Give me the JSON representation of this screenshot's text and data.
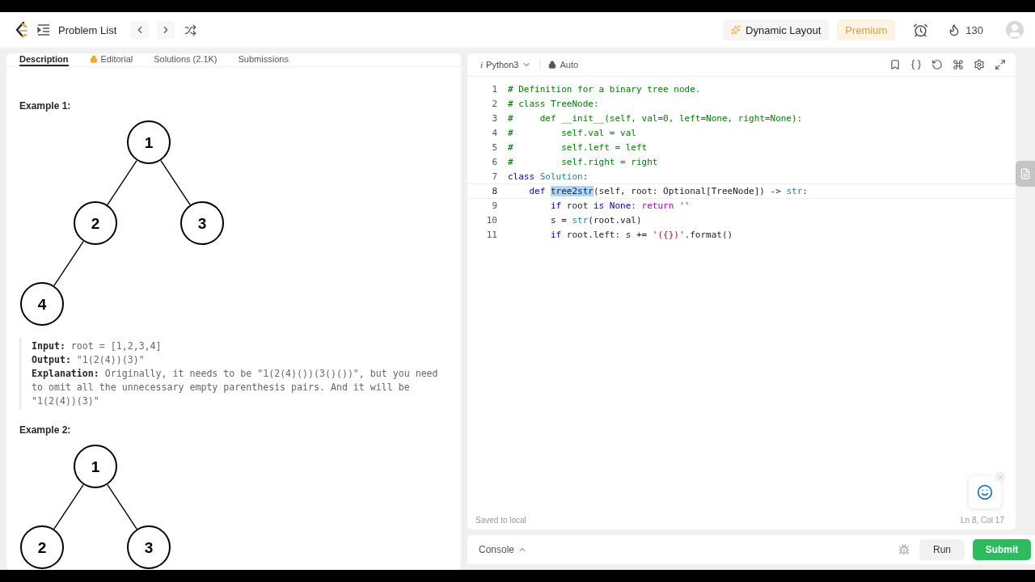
{
  "top_bar": {
    "title": "Problem List",
    "dynamic_layout": "Dynamic Layout",
    "premium": "Premium",
    "streak": "130"
  },
  "left_tabs": [
    {
      "label": "Description",
      "selected": true,
      "locked": false
    },
    {
      "label": "Editorial",
      "selected": false,
      "locked": true
    },
    {
      "label": "Solutions (2.1K)",
      "selected": false,
      "locked": false
    },
    {
      "label": "Submissions",
      "selected": false,
      "locked": false
    }
  ],
  "examples": [
    {
      "title": "Example 1:",
      "tree": {
        "label": "1",
        "children": [
          {
            "label": "2",
            "children": [
              {
                "label": "4"
              }
            ]
          },
          {
            "label": "3"
          }
        ]
      },
      "details": [
        "**Input:** root = [1,2,3,4]",
        "**Output:** \"1(2(4))(3)\"",
        "**Explanation:** Originally, it needs to be \"1(2(4)())(3()())\", but you need to omit all the unnecessary empty parenthesis pairs. And it will be \"1(2(4))(3)\""
      ]
    },
    {
      "title": "Example 2:",
      "tree": {
        "label": "1",
        "children": [
          {
            "label": "2"
          },
          {
            "label": "3"
          }
        ]
      }
    }
  ],
  "editor": {
    "language_icon": "i",
    "language": "Python3",
    "mode": "Auto",
    "status": "Saved to local",
    "cursor": "Ln 8, Col 17",
    "lines": [
      {
        "number": "1",
        "active": false,
        "tokens": [
          {
            "text": "# Definition for a binary tree node.",
            "kind": "comment"
          }
        ]
      },
      {
        "number": "2",
        "active": false,
        "tokens": [
          {
            "text": "# class TreeNode:",
            "kind": "comment"
          }
        ]
      },
      {
        "number": "3",
        "active": false,
        "tokens": [
          {
            "text": "#     def __init__(self, val=0, left=None, right=None):",
            "kind": "comment"
          }
        ]
      },
      {
        "number": "4",
        "active": false,
        "tokens": [
          {
            "text": "#         self.val = val",
            "kind": "comment"
          }
        ]
      },
      {
        "number": "5",
        "active": false,
        "tokens": [
          {
            "text": "#         self.left = left",
            "kind": "comment"
          }
        ]
      },
      {
        "number": "6",
        "active": false,
        "tokens": [
          {
            "text": "#         self.right = right",
            "kind": "comment"
          }
        ]
      },
      {
        "number": "7",
        "active": false,
        "tokens": [
          {
            "text": "class",
            "kind": "keyword"
          },
          {
            "text": " Solution",
            "kind": "type"
          },
          {
            "text": ":",
            "kind": "plain"
          }
        ]
      },
      {
        "number": "8",
        "active": true,
        "tokens": [
          {
            "text": "    def ",
            "kind": "keyword"
          },
          {
            "text": "tree2str",
            "kind": "selection"
          },
          {
            "text": "(self, root: Optional[TreeNode]) -> ",
            "kind": "plain"
          },
          {
            "text": "str",
            "kind": "type"
          },
          {
            "text": ":",
            "kind": "plain"
          }
        ]
      },
      {
        "number": "9",
        "active": false,
        "tokens": [
          {
            "text": "        if",
            "kind": "keyword"
          },
          {
            "text": " root ",
            "kind": "plain"
          },
          {
            "text": "is None",
            "kind": "keyword"
          },
          {
            "text": ": ",
            "kind": "plain"
          },
          {
            "text": "return",
            "kind": "control"
          },
          {
            "text": " ''",
            "kind": "string"
          }
        ]
      },
      {
        "number": "10",
        "active": false,
        "tokens": [
          {
            "text": "        s = ",
            "kind": "plain"
          },
          {
            "text": "str",
            "kind": "type"
          },
          {
            "text": "(root.val)",
            "kind": "plain"
          }
        ]
      },
      {
        "number": "11",
        "active": false,
        "tokens": [
          {
            "text": "        if",
            "kind": "keyword"
          },
          {
            "text": " root.left: s += ",
            "kind": "plain"
          },
          {
            "text": "'({})'",
            "kind": "string"
          },
          {
            "text": ".format()",
            "kind": "plain"
          }
        ]
      }
    ]
  },
  "console": {
    "label": "Console",
    "run": "Run",
    "submit": "Submit"
  }
}
